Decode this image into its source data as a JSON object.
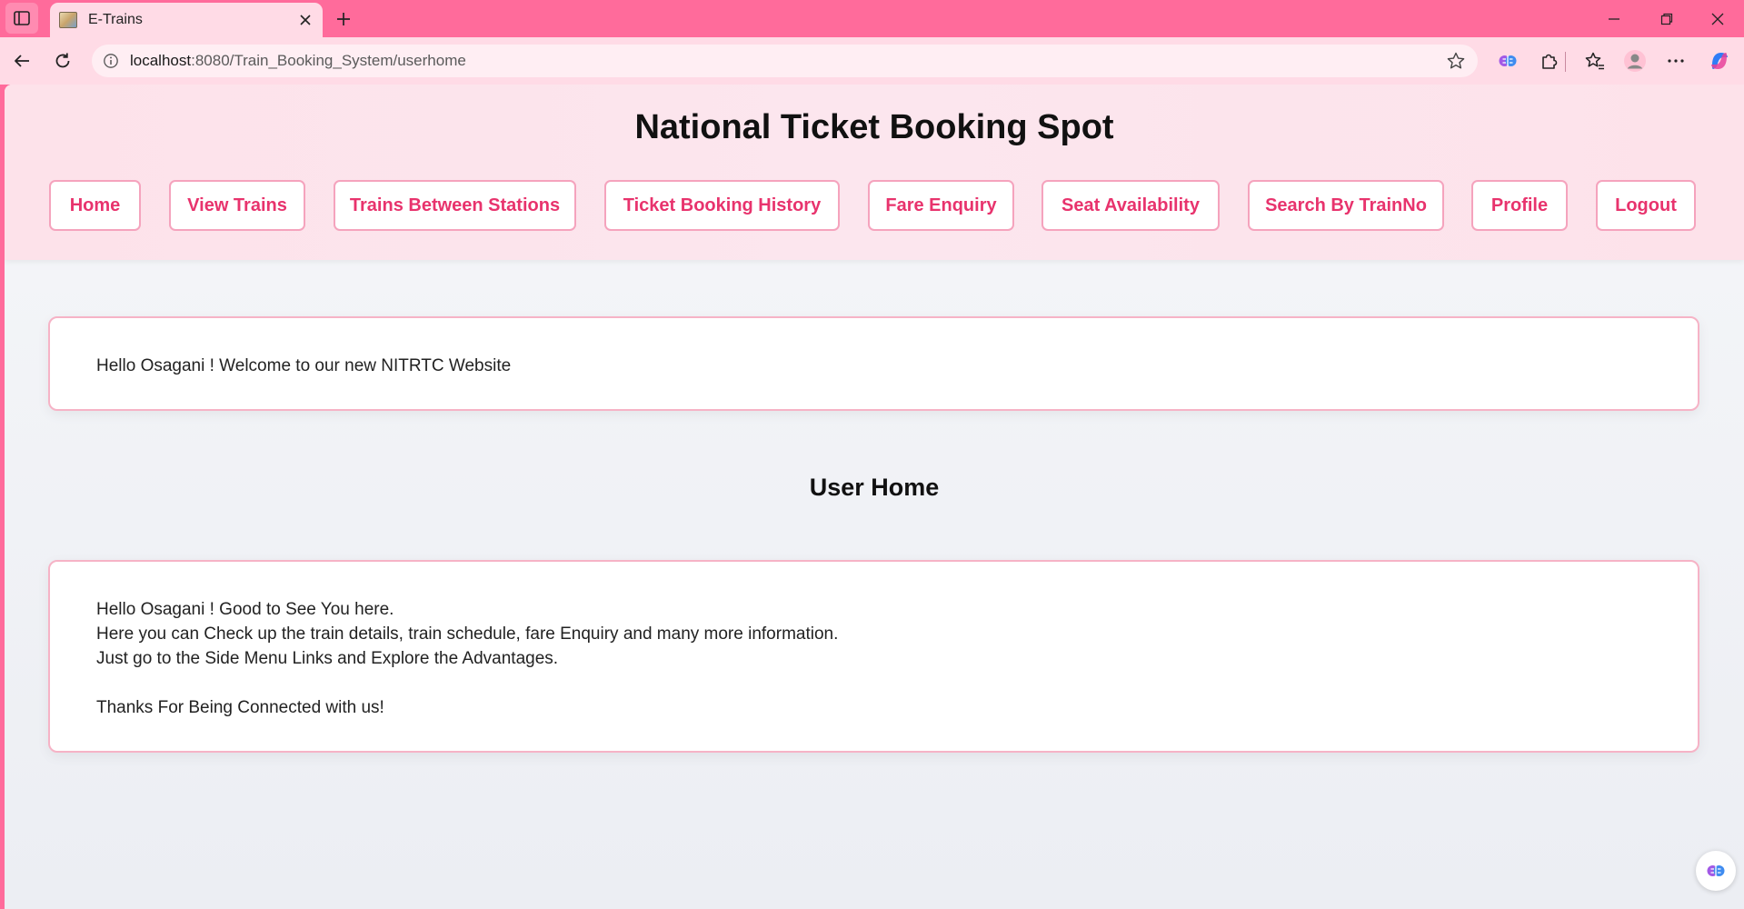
{
  "browser": {
    "tab": {
      "title": "E-Trains"
    },
    "address": {
      "host": "localhost",
      "path": ":8080/Train_Booking_System/userhome"
    }
  },
  "site": {
    "title": "National Ticket Booking Spot",
    "menu": [
      {
        "label": "Home"
      },
      {
        "label": "View Trains"
      },
      {
        "label": "Trains Between Stations"
      },
      {
        "label": "Ticket Booking History"
      },
      {
        "label": "Fare Enquiry"
      },
      {
        "label": "Seat Availability"
      },
      {
        "label": "Search By TrainNo"
      },
      {
        "label": "Profile"
      },
      {
        "label": "Logout"
      }
    ]
  },
  "welcome": {
    "message": "Hello Osagani ! Welcome to our new NITRTC Website"
  },
  "main": {
    "heading": "User Home",
    "lines": [
      "Hello Osagani ! Good to See You here.",
      "Here you can Check up the train details, train schedule, fare Enquiry and many more information.",
      "Just go to the Side Menu Links and Explore the Advantages.",
      "Thanks For Being Connected with us!"
    ]
  },
  "colors": {
    "browser_pink": "#ff6b9b",
    "accent": "#e8336d",
    "button_border": "#f5a3bd"
  },
  "icons": {
    "sidebar_toggle": "sidebar-icon",
    "favicon": "train-favicon-icon",
    "close": "close-icon",
    "new_tab": "plus-icon",
    "minimize": "minimize-icon",
    "restore": "restore-icon",
    "window_close": "window-close-icon",
    "back": "back-arrow-icon",
    "refresh": "refresh-icon",
    "site_info": "info-icon",
    "favorite": "star-icon",
    "copilot_ext": "brain-icon",
    "extensions": "puzzle-icon",
    "favorites": "favorites-icon",
    "profile": "profile-icon",
    "more": "ellipsis-icon",
    "copilot": "copilot-icon"
  }
}
